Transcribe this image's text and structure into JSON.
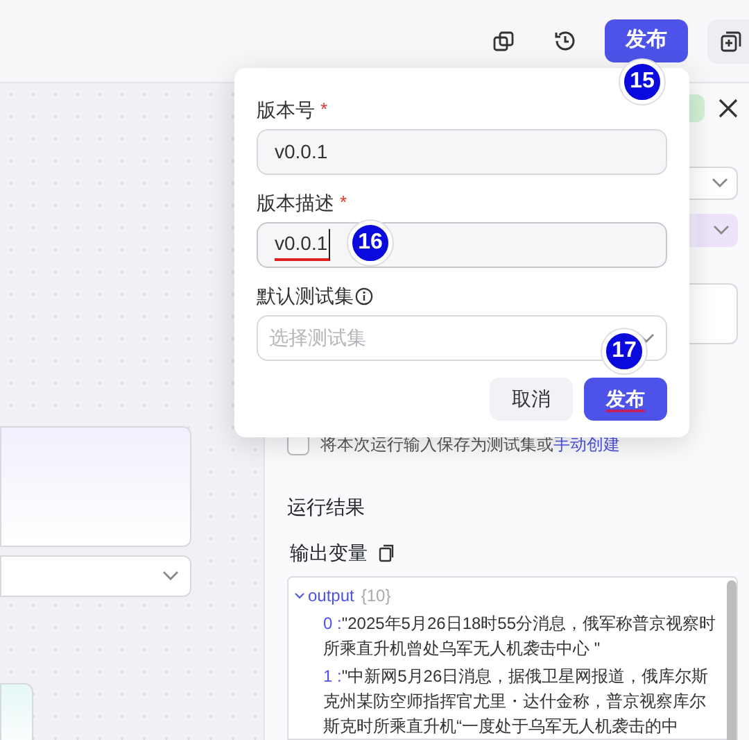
{
  "toolbar": {
    "publish_button": "发布"
  },
  "publish_popover": {
    "fields": [
      {
        "kind": "input",
        "label": "版本号",
        "required_mark": "*",
        "value": "v0.0.1",
        "focused": false
      },
      {
        "kind": "input",
        "label": "版本描述",
        "required_mark": "*",
        "value": "v0.0.1",
        "focused": true
      },
      {
        "kind": "select",
        "label": "默认测试集",
        "placeholder": "选择测试集"
      }
    ],
    "buttons": [
      {
        "label": "取消",
        "primary": false
      },
      {
        "label": "发布",
        "primary": true
      }
    ]
  },
  "annotations": [
    {
      "number": "15"
    },
    {
      "number": "16"
    },
    {
      "number": "17"
    }
  ],
  "right_panel": {
    "save_checkbox": {
      "label": "将本次运行输入保存为测试集或",
      "link": "手动创建",
      "checked": false
    },
    "result_title": "运行结果",
    "output_title": "输出变量",
    "output": {
      "key": "output",
      "count": "{10}",
      "expanded": true,
      "items": [
        {
          "index": "0 :",
          "value": "\"2025年5月26日18时55分消息，俄军称普京视察时所乘直升机曾处乌军无人机袭击中心 \""
        },
        {
          "index": "1 :",
          "value": "\"中新网5月26日消息，据俄卫星网报道，俄库尔斯克州某防空师指挥官尤里・达什金称，普京视察库尔斯克时所乘直升机“一度处于乌军无人机袭击的中"
        }
      ]
    }
  }
}
